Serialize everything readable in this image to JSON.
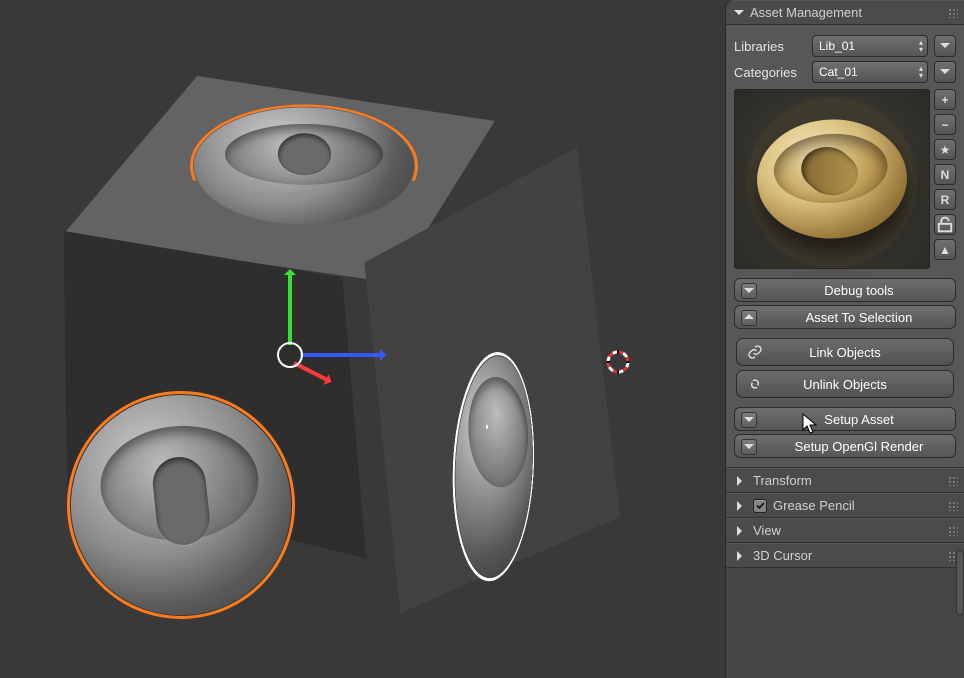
{
  "sidepanel": {
    "assetManagement": {
      "title": "Asset Management",
      "libraries_label": "Libraries",
      "library_value": "Lib_01",
      "categories_label": "Categories",
      "category_value": "Cat_01",
      "toolbar_icons": [
        "plus",
        "minus",
        "star",
        "N",
        "R",
        "lock",
        "up"
      ]
    },
    "debugTools": {
      "title": "Debug tools"
    },
    "assetToSelection": {
      "title": "Asset To Selection",
      "link": "Link Objects",
      "unlink": "Unlink Objects"
    },
    "setupAsset": {
      "title": "Setup Asset"
    },
    "setupRender": {
      "title": "Setup OpenGl Render"
    },
    "transform": {
      "title": "Transform"
    },
    "grease": {
      "title": "Grease Pencil",
      "checked": true
    },
    "view": {
      "title": "View"
    },
    "cursor": {
      "title": "3D Cursor"
    }
  }
}
